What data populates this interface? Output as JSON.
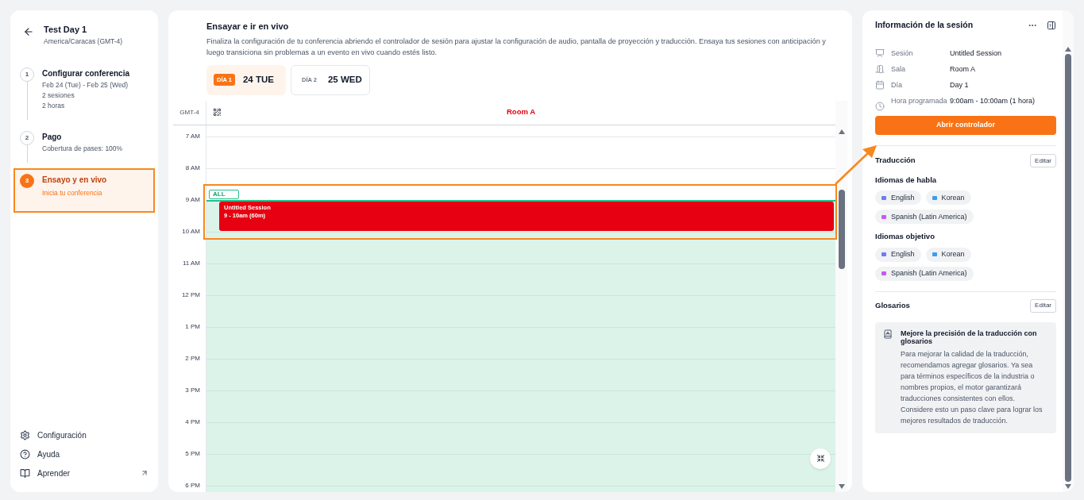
{
  "sidebar": {
    "title": "Test Day 1",
    "timezone": "America/Caracas (GMT-4)",
    "steps": [
      {
        "number": "1",
        "title": "Configurar conferencia",
        "details": [
          "Feb 24 (Tue) - Feb 25 (Wed)",
          "2 sesiones",
          "2 horas"
        ],
        "selected": false
      },
      {
        "number": "2",
        "title": "Pago",
        "details": [
          "Cobertura de pases: 100%"
        ],
        "selected": false
      },
      {
        "number": "3",
        "title": "Ensayo y en vivo",
        "details": [
          "Inicia tu conferencia"
        ],
        "selected": true
      }
    ],
    "footer": [
      {
        "kind": "settings",
        "label": "Configuración"
      },
      {
        "kind": "help",
        "label": "Ayuda"
      },
      {
        "kind": "learn",
        "label": "Aprender"
      }
    ]
  },
  "main": {
    "title": "Ensayar e ir en vivo",
    "description": "Finaliza la configuración de tu conferencia abriendo el controlador de sesión para ajustar la configuración de audio, pantalla de proyección y traducción. Ensaya tus sesiones con anticipación y luego transiciona sin problemas a un evento en vivo cuando estés listo.",
    "days": [
      {
        "tag": "DÍA 1",
        "date": "24 TUE",
        "selected": true
      },
      {
        "tag": "DÍA 2",
        "date": "25 WED",
        "selected": false
      }
    ],
    "calendar": {
      "timezone": "GMT-4",
      "room": "Room A",
      "hours": [
        {
          "label": "7 AM",
          "available": false
        },
        {
          "label": "8 AM",
          "available": false
        },
        {
          "label": "9 AM",
          "available": true
        },
        {
          "label": "10 AM",
          "available": true
        },
        {
          "label": "11 AM",
          "available": true
        },
        {
          "label": "12 PM",
          "available": true
        },
        {
          "label": "1 PM",
          "available": true
        },
        {
          "label": "2 PM",
          "available": true
        },
        {
          "label": "3 PM",
          "available": true
        },
        {
          "label": "4 PM",
          "available": true
        },
        {
          "label": "5 PM",
          "available": true
        },
        {
          "label": "6 PM",
          "available": true
        }
      ],
      "tag": "ALL",
      "session": {
        "title": "Untitled Session",
        "time": "9 - 10am (60m)",
        "color": "#e60012"
      }
    }
  },
  "panel": {
    "title": "Información de la sesión",
    "fields": [
      {
        "kind": "session",
        "label": "Sesión",
        "value": "Untitled Session"
      },
      {
        "kind": "room",
        "label": "Sala",
        "value": "Room A"
      },
      {
        "kind": "day",
        "label": "Día",
        "value": "Day 1"
      },
      {
        "kind": "time",
        "label": "Hora programada",
        "value": "9:00am - 10:00am (1 hora)"
      }
    ],
    "open_button": "Abrir controlador",
    "translation": {
      "title": "Traducción",
      "edit": "Editar",
      "groups": [
        {
          "title": "Idiomas de habla",
          "languages": [
            {
              "name": "English",
              "color": "#6b7cf5"
            },
            {
              "name": "Korean",
              "color": "#3b9cf0"
            },
            {
              "name": "Spanish (Latin America)",
              "color": "#c35cf0"
            }
          ]
        },
        {
          "title": "Idiomas objetivo",
          "languages": [
            {
              "name": "English",
              "color": "#6b7cf5"
            },
            {
              "name": "Korean",
              "color": "#3b9cf0"
            },
            {
              "name": "Spanish (Latin America)",
              "color": "#c35cf0"
            }
          ]
        }
      ]
    },
    "glossary": {
      "title": "Glosarios",
      "edit": "Editar",
      "tip_title": "Mejore la precisión de la traducción con glosarios",
      "tip_text": "Para mejorar la calidad de la traducción, recomendamos agregar glosarios. Ya sea para términos específicos de la industria o nombres propios, el motor garantizará traducciones consistentes con ellos. Considere esto un paso clave para lograr los mejores resultados de traducción."
    }
  }
}
